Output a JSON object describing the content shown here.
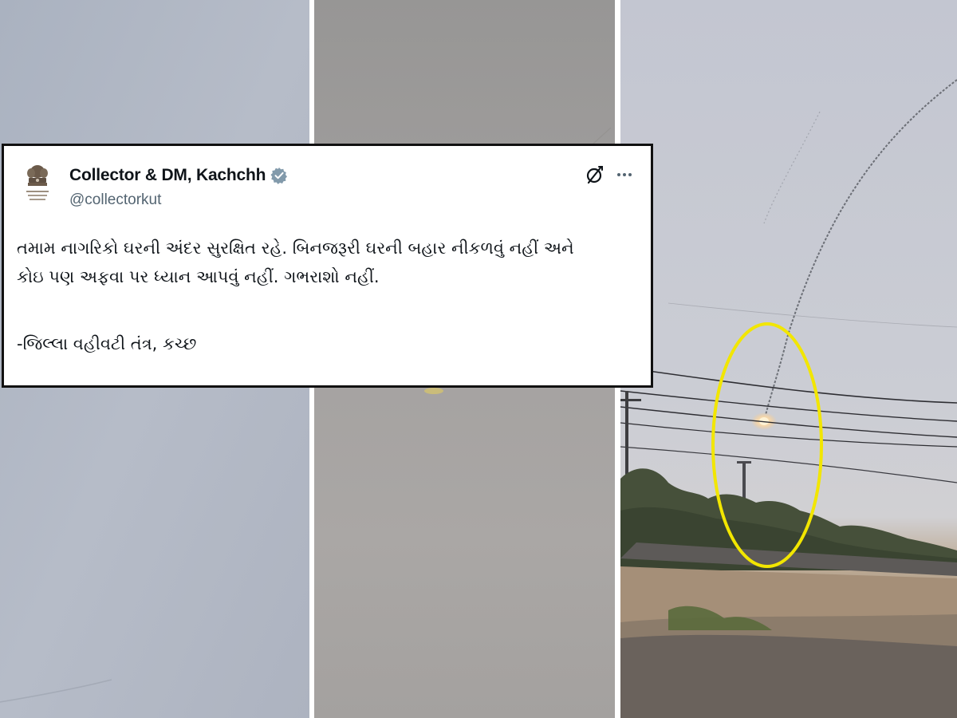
{
  "tweet": {
    "display_name": "Collector & DM, Kachchh",
    "handle": "@collectorkut",
    "verified": true,
    "verified_color": "#829aab",
    "body_lines": [
      "તમામ નાગરિકો ઘરની અંદર સુરક્ષિત રહે. બિનજરૂરી ઘરની બહાર નીકળવું નહીં અને",
      "કોઇ પણ અફવા પર ધ્યાન આપવું નહીં. ગભરાશો નહીં."
    ],
    "signature": "-જિલ્લા વહીવટી તંત્ર, કચ્છ",
    "avatar_icon": "government-emblem-icon",
    "actions": {
      "grok_icon": "grok-icon",
      "more_icon": "more-options-icon"
    }
  },
  "panels": [
    {
      "name": "left-sky-frame",
      "scene": "hazy sky"
    },
    {
      "name": "middle-sky-frame",
      "scene": "hazy sky"
    },
    {
      "name": "right-sky-frame",
      "scene": "sky with missile trail over power lines and scrubland"
    }
  ],
  "highlight": {
    "shape": "ellipse",
    "color": "#f2e600"
  }
}
